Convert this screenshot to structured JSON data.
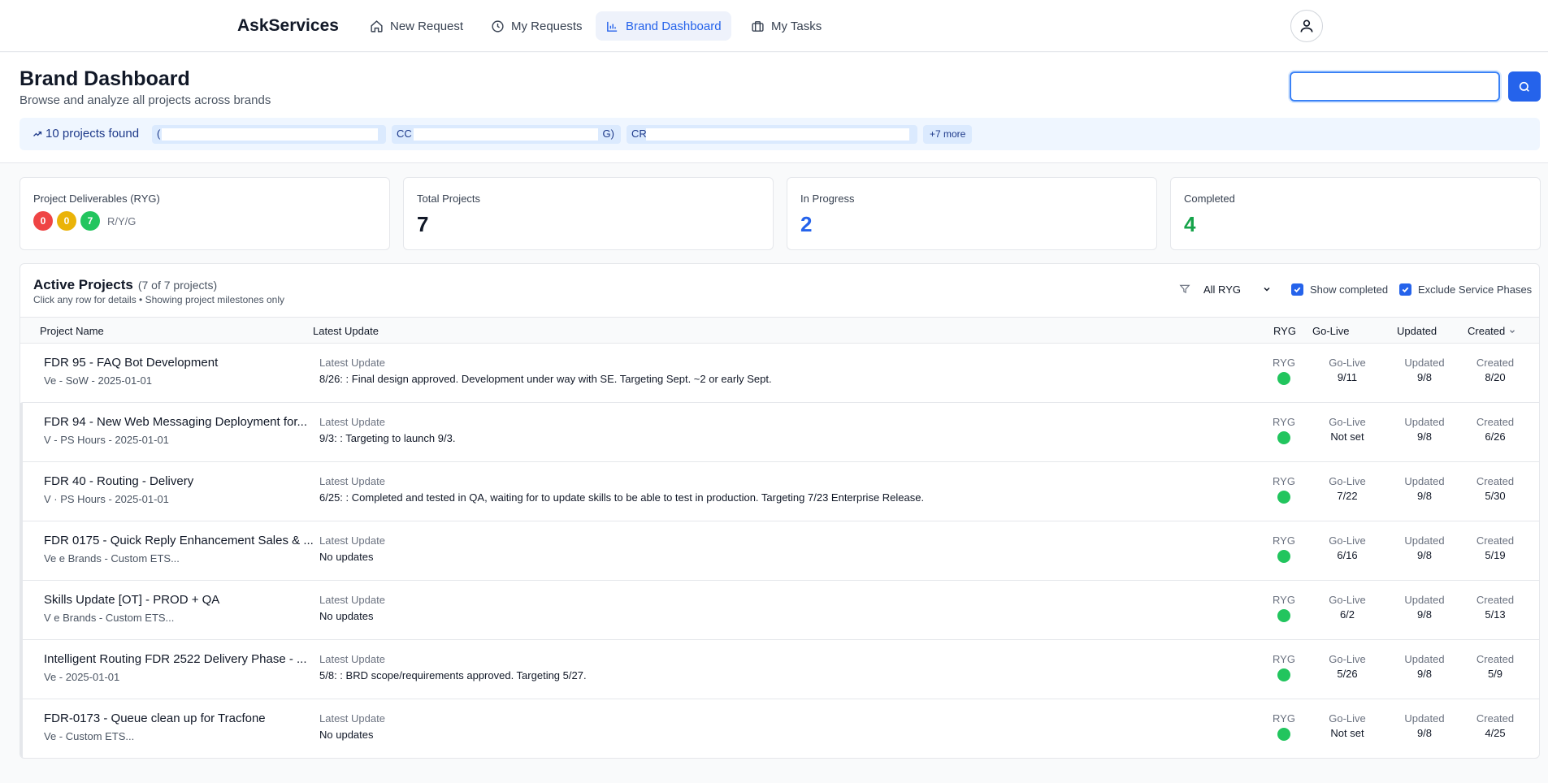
{
  "nav": {
    "brand": "AskServices",
    "items": [
      {
        "label": "New Request",
        "icon": "home-icon",
        "active": false
      },
      {
        "label": "My Requests",
        "icon": "clock-icon",
        "active": false
      },
      {
        "label": "Brand Dashboard",
        "icon": "bar-chart-icon",
        "active": true
      },
      {
        "label": "My Tasks",
        "icon": "briefcase-icon",
        "active": false
      }
    ],
    "avatar_icon": "user-icon"
  },
  "header": {
    "title": "Brand Dashboard",
    "subtitle": "Browse and analyze all projects across brands",
    "search_placeholder": "",
    "search_icon": "search-icon"
  },
  "found_bar": {
    "text": "10 projects found",
    "icon": "trending-up-icon",
    "chips": [
      {
        "prefix": "(",
        "suffix": "..."
      },
      {
        "prefix": "CC",
        "suffix": "G)"
      },
      {
        "prefix": "CR",
        "suffix": ""
      }
    ],
    "more": "+7 more"
  },
  "stats": {
    "deliverables_label": "Project Deliverables (RYG)",
    "red": "0",
    "yellow": "0",
    "green": "7",
    "ryg_legend": "R/Y/G",
    "total_label": "Total Projects",
    "total_value": "7",
    "inprogress_label": "In Progress",
    "inprogress_value": "2",
    "completed_label": "Completed",
    "completed_value": "4"
  },
  "colors": {
    "accent": "#2563eb",
    "red": "#ef4444",
    "yellow": "#eab308",
    "green": "#22c55e",
    "completed_text": "#16a34a"
  },
  "projects": {
    "title": "Active Projects",
    "count": "(7 of 7 projects)",
    "subtitle": "Click any row for details • Showing project milestones only",
    "filter_value": "All RYG",
    "show_completed": "Show completed",
    "exclude_service": "Exclude Service Phases",
    "columns": {
      "name": "Project Name",
      "latest": "Latest Update",
      "ryg": "RYG",
      "golive": "Go-Live",
      "updated": "Updated",
      "created": "Created"
    },
    "row_labels": {
      "latest": "Latest Update",
      "ryg": "RYG",
      "golive": "Go-Live",
      "updated": "Updated",
      "created": "Created"
    },
    "rows": [
      {
        "name": "FDR 95 -            FAQ Bot Development",
        "sub": "Ve                                    - SoW - 2025-01-01",
        "update": "8/26: : Final design approved. Development under way with SE. Targeting Sept. ~2 or early Sept.",
        "golive": "9/11",
        "updated": "9/8",
        "created": "8/20"
      },
      {
        "name": "FDR 94 - New Web Messaging Deployment for...",
        "sub": "V                                      - PS Hours - 2025-01-01",
        "update": "9/3: : Targeting to launch 9/3.",
        "golive": "Not set",
        "updated": "9/8",
        "created": "6/26"
      },
      {
        "name": "FDR 40 -                        Routing - Delivery",
        "sub": "V                                      · PS Hours - 2025-01-01",
        "update": "6/25: : Completed and tested in QA, waiting for                            to update skills to be able to test in production. Targeting 7/23 Enterprise Release.",
        "golive": "7/22",
        "updated": "9/8",
        "created": "5/30"
      },
      {
        "name": "FDR 0175 - Quick Reply Enhancement Sales & ...",
        "sub": "Ve                                          e Brands - Custom ETS...",
        "update": "No updates",
        "golive": "6/16",
        "updated": "9/8",
        "created": "5/19"
      },
      {
        "name": "Skills Update [OT] - PROD + QA",
        "sub": "V                                           e Brands - Custom ETS...",
        "update": "No updates",
        "golive": "6/2",
        "updated": "9/8",
        "created": "5/13"
      },
      {
        "name": "Intelligent Routing FDR 2522 Delivery Phase - ...",
        "sub": "Ve                                                  - 2025-01-01",
        "update": "5/8: : BRD scope/requirements approved. Targeting 5/27.",
        "golive": "5/26",
        "updated": "9/8",
        "created": "5/9"
      },
      {
        "name": "FDR-0173 - Queue clean up for Tracfone",
        "sub": "Ve                                                  - Custom ETS...",
        "update": "No updates",
        "golive": "Not set",
        "updated": "9/8",
        "created": "4/25"
      }
    ]
  }
}
